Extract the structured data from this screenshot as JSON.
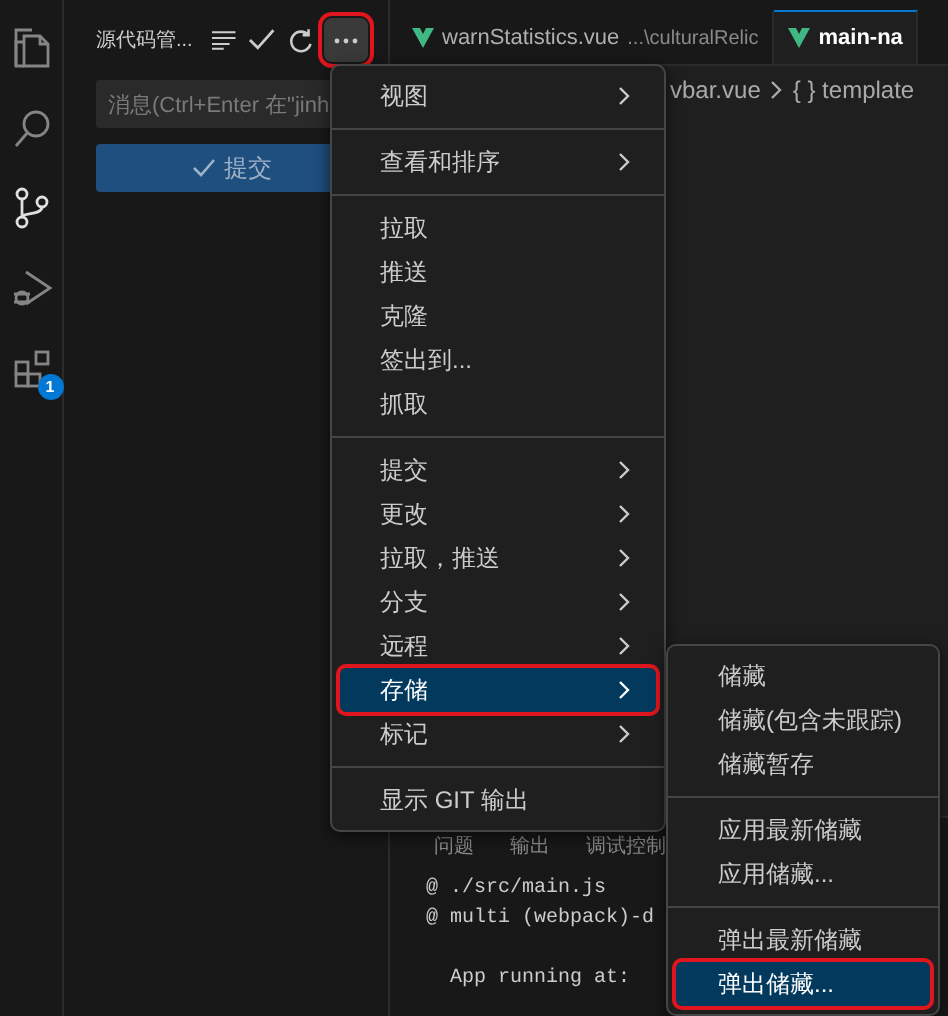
{
  "activity_bar": {
    "items": [
      {
        "kind": "files",
        "selected": false
      },
      {
        "kind": "search",
        "selected": false
      },
      {
        "kind": "source-control",
        "selected": true
      },
      {
        "kind": "run",
        "selected": false
      },
      {
        "kind": "extensions",
        "selected": false,
        "badge": "1"
      }
    ]
  },
  "sidebar": {
    "title": "源代码管...",
    "more_highlighted": true,
    "message_placeholder": "消息(Ctrl+Enter 在\"jinh",
    "commit_label": "提交"
  },
  "tabs": [
    {
      "name": "warnStatistics.vue",
      "description": "...\\culturalRelic",
      "selected": false
    },
    {
      "name": "main-na",
      "selected": true
    }
  ],
  "breadcrumb": [
    "vbar.vue",
    "{ } template"
  ],
  "panel": {
    "tabs": [
      "问题",
      "输出",
      "调试控制"
    ],
    "lines": [
      "@ ./src/main.js",
      "@ multi (webpack)-d",
      "  App running at:"
    ]
  },
  "menu": {
    "groups": [
      [
        {
          "label": "视图",
          "submenu": true,
          "selected": false,
          "highlighted": false
        }
      ],
      [
        {
          "label": "查看和排序",
          "submenu": true,
          "selected": false,
          "highlighted": false
        }
      ],
      [
        {
          "label": "拉取",
          "submenu": false,
          "selected": false,
          "highlighted": false
        },
        {
          "label": "推送",
          "submenu": false,
          "selected": false,
          "highlighted": false
        },
        {
          "label": "克隆",
          "submenu": false,
          "selected": false,
          "highlighted": false
        },
        {
          "label": "签出到...",
          "submenu": false,
          "selected": false,
          "highlighted": false
        },
        {
          "label": "抓取",
          "submenu": false,
          "selected": false,
          "highlighted": false
        }
      ],
      [
        {
          "label": "提交",
          "submenu": true,
          "selected": false,
          "highlighted": false
        },
        {
          "label": "更改",
          "submenu": true,
          "selected": false,
          "highlighted": false
        },
        {
          "label": "拉取，推送",
          "submenu": true,
          "selected": false,
          "highlighted": false
        },
        {
          "label": "分支",
          "submenu": true,
          "selected": false,
          "highlighted": false
        },
        {
          "label": "远程",
          "submenu": true,
          "selected": false,
          "highlighted": false
        },
        {
          "label": "存储",
          "submenu": true,
          "selected": true,
          "highlighted": true
        },
        {
          "label": "标记",
          "submenu": true,
          "selected": false,
          "highlighted": false
        }
      ],
      [
        {
          "label": "显示 GIT 输出",
          "submenu": false,
          "selected": false,
          "highlighted": false
        }
      ]
    ]
  },
  "submenu": {
    "groups": [
      [
        {
          "label": "储藏",
          "selected": false,
          "highlighted": false
        },
        {
          "label": "储藏(包含未跟踪)",
          "selected": false,
          "highlighted": false
        },
        {
          "label": "储藏暂存",
          "selected": false,
          "highlighted": false
        }
      ],
      [
        {
          "label": "应用最新储藏",
          "selected": false,
          "highlighted": false
        },
        {
          "label": "应用储藏...",
          "selected": false,
          "highlighted": false
        }
      ],
      [
        {
          "label": "弹出最新储藏",
          "selected": false,
          "highlighted": false
        },
        {
          "label": "弹出储藏...",
          "selected": true,
          "highlighted": true
        }
      ]
    ]
  }
}
